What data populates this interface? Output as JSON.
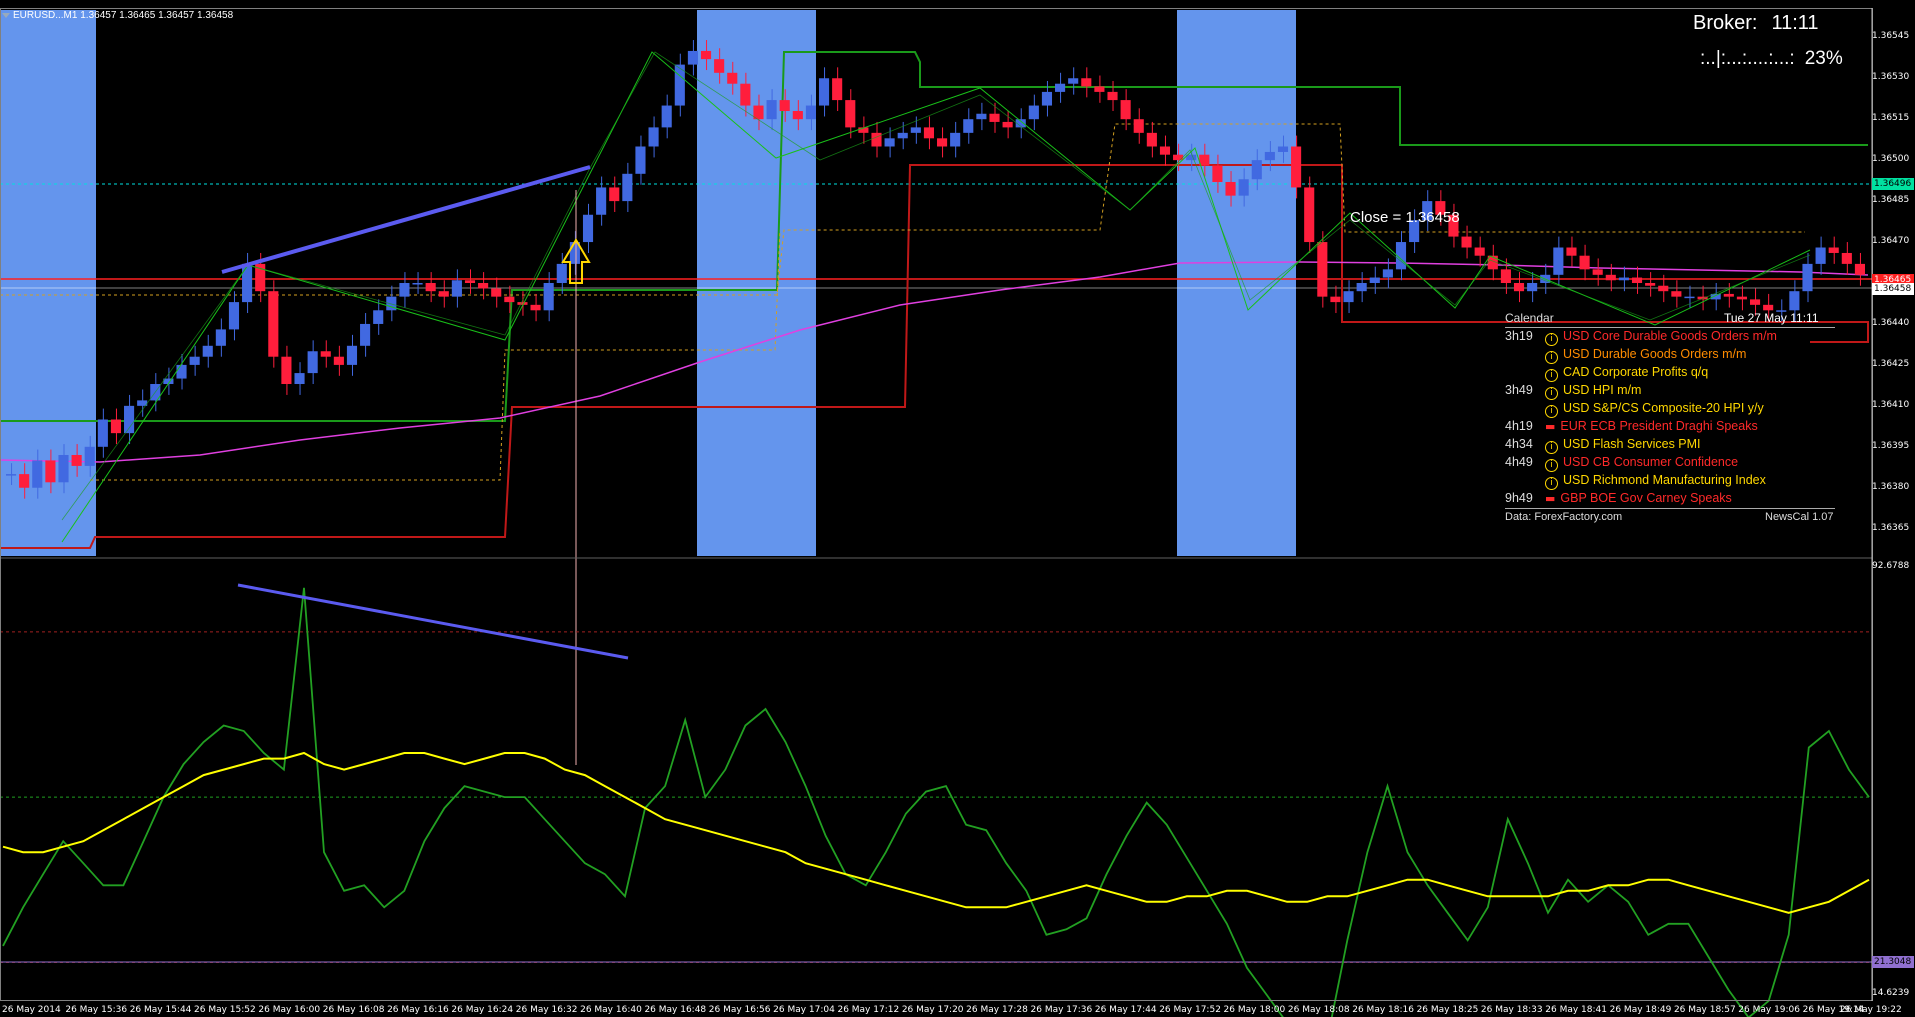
{
  "symbol_header": "EURUSD...M1  1.36457 1.36465 1.36457 1.36458",
  "broker": {
    "label": "Broker:",
    "time": "11:11"
  },
  "bar_progress": {
    "dots": ":..|:...:....:...:",
    "percent": "23%"
  },
  "close_label": "Close = 1.36458",
  "calendar": {
    "title": "Calendar",
    "date": "Tue 27 May 11:11",
    "events": [
      {
        "time": "3h19",
        "icon": "info-icon",
        "text": "USD Core Durable Goods Orders m/m",
        "color": "#ff2a2a"
      },
      {
        "time": "",
        "icon": "info-icon",
        "text": "USD Durable Goods Orders m/m",
        "color": "#ff8c00"
      },
      {
        "time": "",
        "icon": "info-icon",
        "text": "CAD Corporate Profits q/q",
        "color": "#ffd700"
      },
      {
        "time": "3h49",
        "icon": "info-icon",
        "text": "USD HPI m/m",
        "color": "#ffd700"
      },
      {
        "time": "",
        "icon": "info-icon",
        "text": "USD S&P/CS Composite-20 HPI y/y",
        "color": "#ffd700"
      },
      {
        "time": "4h19",
        "icon": "speech-icon",
        "text": "EUR ECB President Draghi Speaks",
        "color": "#ff2a2a"
      },
      {
        "time": "4h34",
        "icon": "info-icon",
        "text": "USD Flash Services PMI",
        "color": "#ffd700"
      },
      {
        "time": "4h49",
        "icon": "info-icon",
        "text": "USD CB Consumer Confidence",
        "color": "#ff2a2a"
      },
      {
        "time": "",
        "icon": "info-icon",
        "text": "USD Richmond Manufacturing Index",
        "color": "#ffd700"
      },
      {
        "time": "9h49",
        "icon": "speech-icon",
        "text": "GBP BOE Gov Carney Speaks",
        "color": "#ff2a2a"
      }
    ],
    "source": "Data: ForexFactory.com",
    "version": "NewsCal 1.07"
  },
  "price_axis": {
    "labels": [
      "1.36545",
      "1.36530",
      "1.36515",
      "1.36500",
      "1.36485",
      "1.36470",
      "1.36455",
      "1.36440",
      "1.36425",
      "1.36410",
      "1.36395",
      "1.36380",
      "1.36365"
    ],
    "current_badge": "1.36496",
    "bid_badge": "1.36458",
    "red_badge": "1.36465"
  },
  "osc_axis": {
    "top": "92.6788",
    "badge": "21.3048",
    "bottom": "14.6239"
  },
  "time_axis": [
    "26 May 2014",
    "26 May 15:36",
    "26 May 15:44",
    "26 May 15:52",
    "26 May 16:00",
    "26 May 16:08",
    "26 May 16:16",
    "26 May 16:24",
    "26 May 16:32",
    "26 May 16:40",
    "26 May 16:48",
    "26 May 16:56",
    "26 May 17:04",
    "26 May 17:12",
    "26 May 17:20",
    "26 May 17:28",
    "26 May 17:36",
    "26 May 17:44",
    "26 May 17:52",
    "26 May 18:00",
    "26 May 18:08",
    "26 May 18:16",
    "26 May 18:25",
    "26 May 18:33",
    "26 May 18:41",
    "26 May 18:49",
    "26 May 18:57",
    "26 May 19:06",
    "26 May 19:14",
    "26 May 19:22"
  ],
  "colors": {
    "session_band": "#6495ed",
    "bull_candle": "#4169e1",
    "bear_candle": "#ff1e3c",
    "oscillator": "#22a022",
    "signal": "#ffff00",
    "ma": "#e040e0",
    "trendline": "#5b5bf0"
  },
  "chart_data": {
    "type": "line",
    "price_range": [
      1.36355,
      1.36555
    ],
    "closes": [
      1.36385,
      1.3638,
      1.3639,
      1.36382,
      1.36392,
      1.36388,
      1.36395,
      1.36405,
      1.364,
      1.3641,
      1.36412,
      1.36418,
      1.3642,
      1.36425,
      1.36428,
      1.36432,
      1.36438,
      1.36448,
      1.36462,
      1.36452,
      1.36428,
      1.36418,
      1.36422,
      1.3643,
      1.36428,
      1.36425,
      1.36432,
      1.3644,
      1.36445,
      1.3645,
      1.36455,
      1.36455,
      1.36452,
      1.3645,
      1.36456,
      1.36455,
      1.36453,
      1.3645,
      1.36448,
      1.36447,
      1.36445,
      1.36455,
      1.36462,
      1.3647,
      1.3648,
      1.3649,
      1.36485,
      1.36495,
      1.36505,
      1.36512,
      1.3652,
      1.36535,
      1.3654,
      1.36537,
      1.36532,
      1.36528,
      1.3652,
      1.36515,
      1.36522,
      1.36518,
      1.36515,
      1.3652,
      1.3653,
      1.36522,
      1.36512,
      1.3651,
      1.36505,
      1.36508,
      1.3651,
      1.36512,
      1.36508,
      1.36505,
      1.3651,
      1.36515,
      1.36517,
      1.36514,
      1.36512,
      1.36515,
      1.3652,
      1.36525,
      1.36528,
      1.3653,
      1.36527,
      1.36525,
      1.36522,
      1.36515,
      1.3651,
      1.36505,
      1.36502,
      1.365,
      1.36502,
      1.36498,
      1.36492,
      1.36487,
      1.36493,
      1.365,
      1.36503,
      1.36505,
      1.3649,
      1.3647,
      1.3645,
      1.36448,
      1.36452,
      1.36455,
      1.36457,
      1.3646,
      1.3647,
      1.36478,
      1.36485,
      1.3648,
      1.36472,
      1.36468,
      1.36465,
      1.3646,
      1.36455,
      1.36452,
      1.36455,
      1.36458,
      1.36468,
      1.36465,
      1.3646,
      1.36458,
      1.36456,
      1.36457,
      1.36455,
      1.36454,
      1.36452,
      1.3645,
      1.3645,
      1.36449,
      1.36451,
      1.3645,
      1.36449,
      1.36447,
      1.36445,
      1.36445,
      1.36452,
      1.36462,
      1.36468,
      1.36466,
      1.36462,
      1.36458
    ],
    "oscillator": [
      23,
      30,
      36,
      42,
      38,
      34,
      34,
      42,
      50,
      56,
      60,
      63,
      62,
      58,
      55,
      88,
      40,
      33,
      34,
      30,
      33,
      42,
      48,
      52,
      51,
      50,
      50,
      46,
      42,
      38,
      36,
      32,
      48,
      52,
      64,
      50,
      55,
      63,
      66,
      60,
      52,
      43,
      36,
      34,
      40,
      47,
      51,
      52,
      45,
      44,
      38,
      33,
      25,
      26,
      28,
      36,
      43,
      49,
      45,
      39,
      33,
      27,
      19,
      14,
      9,
      4,
      6,
      24,
      40,
      52,
      40,
      34,
      29,
      24,
      30,
      46,
      38,
      29,
      35,
      31,
      34,
      31,
      25,
      27,
      27,
      21,
      15,
      10,
      13,
      25,
      59,
      62,
      55,
      50
    ],
    "signal": [
      41,
      40,
      40,
      41,
      42,
      44,
      46,
      48,
      50,
      52,
      54,
      55,
      56,
      57,
      57,
      58,
      56,
      55,
      56,
      57,
      58,
      58,
      57,
      56,
      57,
      58,
      58,
      57,
      55,
      54,
      52,
      50,
      48,
      46,
      45,
      44,
      43,
      42,
      41,
      40,
      38,
      37,
      36,
      35,
      34,
      33,
      32,
      31,
      30,
      30,
      30,
      31,
      32,
      33,
      34,
      33,
      32,
      31,
      31,
      32,
      32,
      33,
      33,
      32,
      31,
      31,
      32,
      32,
      33,
      34,
      35,
      35,
      34,
      33,
      32,
      32,
      32,
      32,
      33,
      33,
      34,
      34,
      35,
      35,
      34,
      33,
      32,
      31,
      30,
      29,
      30,
      31,
      33,
      35
    ],
    "osc_range": [
      14.6239,
      92.6788
    ],
    "osc_levels": [
      80,
      50,
      20
    ]
  }
}
